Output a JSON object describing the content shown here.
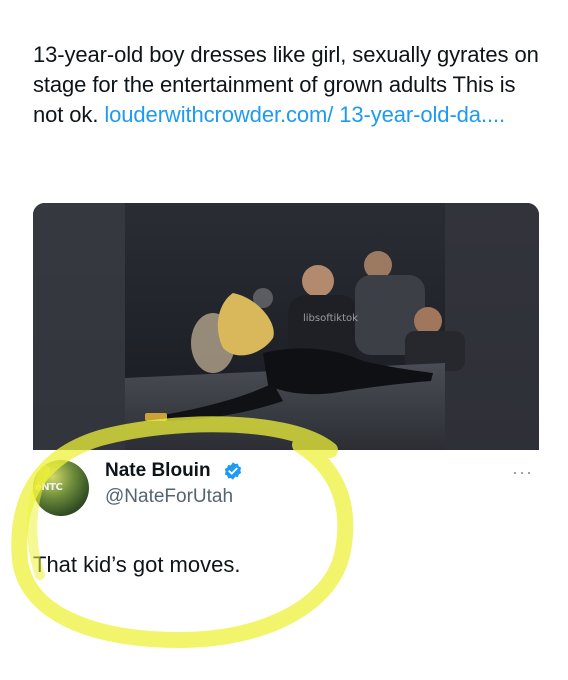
{
  "tweet": {
    "text": "13-year-old boy dresses like girl, sexually gyrates on stage for the entertainment of grown adults This is not ok. ",
    "link_text": "louderwithcrowder.com/ 13-year-old-da...."
  },
  "media": {
    "watermark": "libsoftiktok",
    "description_icon": "video-thumbnail"
  },
  "reply": {
    "display_name": "Nate Blouin",
    "handle": "@NateForUtah",
    "avatar_tag": "éNTC",
    "more_label": "···",
    "text": "That kid’s got moves."
  },
  "colors": {
    "link": "#1d9bf0",
    "verified": "#1d9bf0",
    "secondary_text": "#536471",
    "highlight": "#eef23a"
  }
}
